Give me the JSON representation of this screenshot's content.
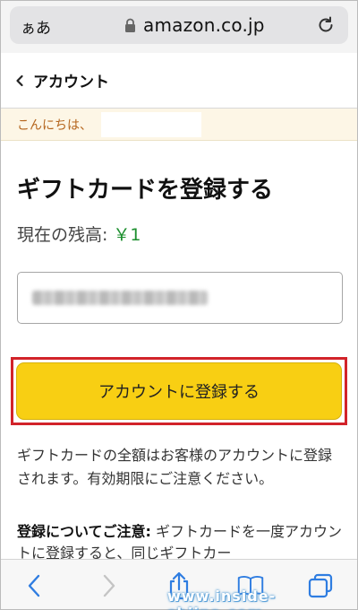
{
  "browser": {
    "text_size_label": "ぁあ",
    "url": "amazon.co.jp"
  },
  "nav": {
    "back_label": "アカウント"
  },
  "greeting": {
    "text": "こんにちは、"
  },
  "main": {
    "title": "ギフトカードを登録する",
    "balance_label": "現在の残高:",
    "balance_value": "￥1",
    "register_button_label": "アカウントに登録する",
    "description": "ギフトカードの全額はお客様のアカウントに登録されます。有効期限にご注意ください。",
    "notice_heading": "登録についてご注意:",
    "notice_text": " ギフトカードを一度アカウントに登録すると、同じギフトカー"
  },
  "watermark": "www.inside-shiina.com",
  "colors": {
    "button": "#f8cf13",
    "highlight_border": "#d2232a",
    "balance": "#1c8f2e",
    "greeting_text": "#b5651d",
    "toolbar_icons": "#2f7de1"
  },
  "icons": {
    "lock": "lock-icon",
    "reload": "reload-icon",
    "back": "chevron-left-icon",
    "share": "share-icon",
    "bookmarks": "book-icon",
    "tabs": "tabs-icon"
  }
}
